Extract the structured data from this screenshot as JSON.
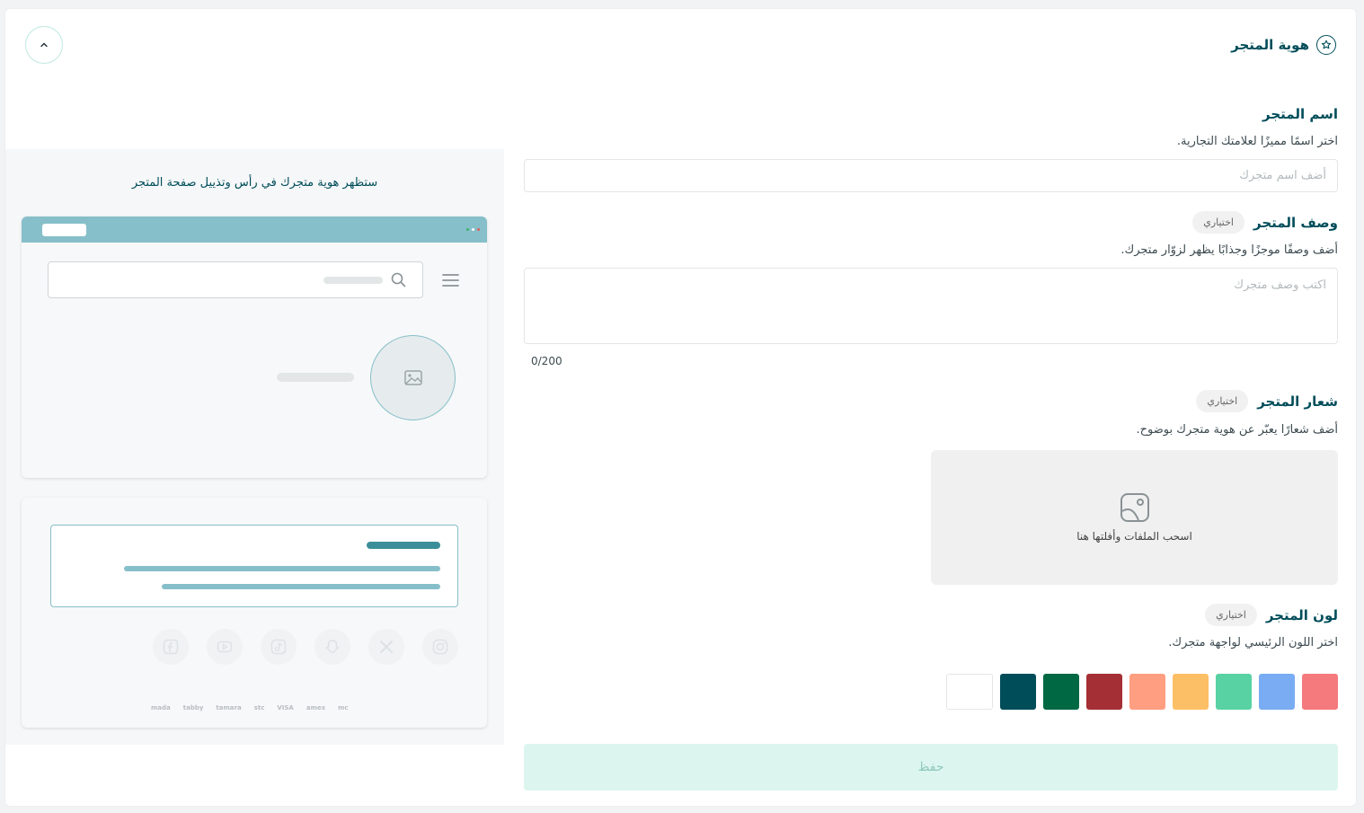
{
  "section": {
    "title": "هوية المتجر",
    "icon": "star-badge-icon"
  },
  "name_field": {
    "label": "اسم المتجر",
    "hint": "اختر اسمًا مميزًا لعلامتك التجارية.",
    "placeholder": "أضف اسم متجرك"
  },
  "desc_field": {
    "label": "وصف المتجر",
    "badge": "اختياري",
    "hint": "أضف وصفًا موجزًا وجذابًا يظهر لزوّار متجرك.",
    "placeholder": "اكتب وصف متجرك",
    "counter": "0/200"
  },
  "logo_field": {
    "label": "شعار المتجر",
    "badge": "اختياري",
    "hint": "أضف شعارًا يعبّر عن هوية متجرك بوضوح.",
    "drop_text": "اسحب الملفات وأفلتها هنا"
  },
  "color_field": {
    "label": "لون المتجر",
    "badge": "اختياري",
    "hint": "اختر اللون الرئيسي لواجهة متجرك.",
    "colors": [
      "#f47a7e",
      "#79acf2",
      "#58d2a2",
      "#fdbf66",
      "#ff9e80",
      "#a42f34",
      "#006843",
      "#004d5a",
      "#ffffff"
    ]
  },
  "save_label": "حفظ",
  "preview": {
    "title": "ستظهر هوية متجرك في رأس وتذييل صفحة المتجر",
    "payments": [
      "mada",
      "tabby",
      "tamara",
      "stc",
      "VISA",
      "amex",
      "mc"
    ]
  }
}
